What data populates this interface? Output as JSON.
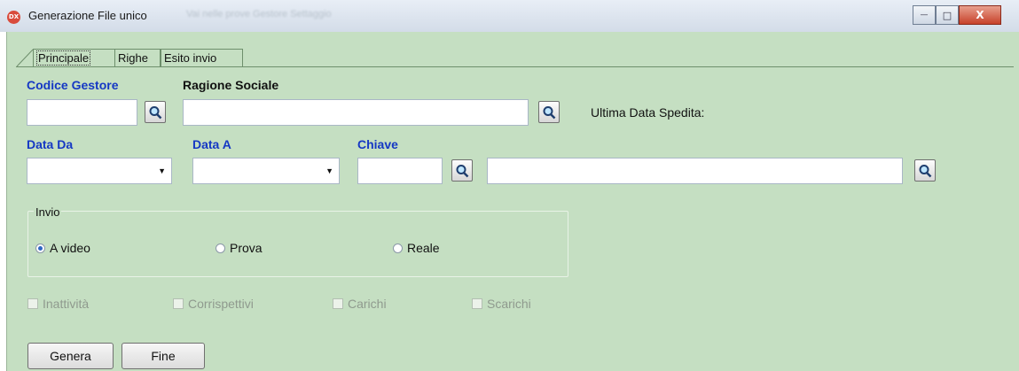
{
  "window": {
    "title": "Generazione File unico",
    "ghost_title": "Vai nelle prove Gestore Settaggio",
    "app_icon_text": "DX",
    "controls": {
      "minimize": "—",
      "maximize": "□",
      "close": "X"
    }
  },
  "tabs": [
    "Principale",
    "Righe",
    "Esito invio"
  ],
  "labels": {
    "codice_gestore": "Codice Gestore",
    "ragione_sociale": "Ragione Sociale",
    "ultima_data": "Ultima Data Spedita:",
    "data_da": "Data Da",
    "data_a": "Data A",
    "chiave": "Chiave"
  },
  "fields": {
    "codice_gestore": "",
    "ragione_sociale": "",
    "data_da": "",
    "data_a": "",
    "chiave": "",
    "chiave_desc": ""
  },
  "invio": {
    "legend": "Invio",
    "options": [
      "A video",
      "Prova",
      "Reale"
    ],
    "selected": "A video"
  },
  "checkboxes": [
    "Inattività",
    "Corrispettivi",
    "Carichi",
    "Scarichi"
  ],
  "buttons": {
    "genera": "Genera",
    "fine": "Fine"
  },
  "colors": {
    "background": "#c5dfc2",
    "label_blue": "#1538c4",
    "selected_radio": "#2f66c4"
  }
}
